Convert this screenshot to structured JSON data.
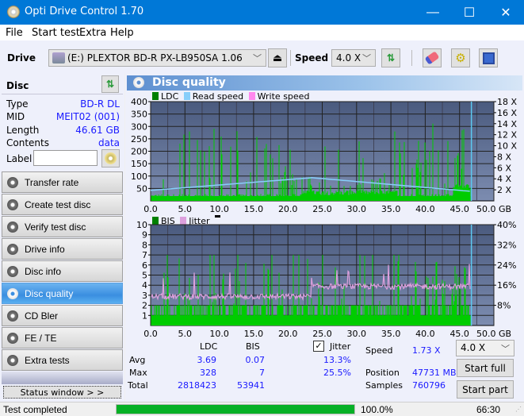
{
  "window": {
    "title": "Opti Drive Control 1.70",
    "minimize": "—",
    "maximize": "☐",
    "close": "✕"
  },
  "menu": [
    {
      "label": "File"
    },
    {
      "label": "Start test"
    },
    {
      "label": "Extra"
    },
    {
      "label": "Help"
    }
  ],
  "toolbar": {
    "drive_label": "Drive",
    "drive_value": "(E:)  PLEXTOR BD-R  PX-LB950SA 1.06",
    "speed_label": "Speed",
    "speed_value": "4.0 X"
  },
  "disc": {
    "header": "Disc",
    "fields": [
      {
        "label": "Type",
        "value": "BD-R DL"
      },
      {
        "label": "MID",
        "value": "MEIT02 (001)"
      },
      {
        "label": "Length",
        "value": "46.61 GB"
      },
      {
        "label": "Contents",
        "value": "data"
      }
    ],
    "label_field": {
      "label": "Label",
      "value": ""
    }
  },
  "nav": [
    {
      "label": "Transfer rate",
      "active": false
    },
    {
      "label": "Create test disc",
      "active": false
    },
    {
      "label": "Verify test disc",
      "active": false
    },
    {
      "label": "Drive info",
      "active": false
    },
    {
      "label": "Disc info",
      "active": false
    },
    {
      "label": "Disc quality",
      "active": true
    },
    {
      "label": "CD Bler",
      "active": false
    },
    {
      "label": "FE / TE",
      "active": false
    },
    {
      "label": "Extra tests",
      "active": false
    }
  ],
  "status_window_button": "Status window > >",
  "main": {
    "title": "Disc quality"
  },
  "chart_data": [
    {
      "type": "bar",
      "title": "LDC / Read speed",
      "legend": [
        "LDC",
        "Read speed",
        "Write speed"
      ],
      "legend_colors": {
        "LDC": "#008000",
        "Read speed": "#87cefa",
        "Write speed": "#ff88ee"
      },
      "xlabel": "GB",
      "x_ticks": [
        "0.0",
        "5.0",
        "10.0",
        "15.0",
        "20.0",
        "25.0",
        "30.0",
        "35.0",
        "40.0",
        "45.0",
        "50.0 GB"
      ],
      "xlim": [
        0,
        50
      ],
      "y_ticks": [
        "50",
        "100",
        "150",
        "200",
        "250",
        "300",
        "350",
        "400"
      ],
      "ylim": [
        0,
        400
      ],
      "y2_ticks": [
        "2 X",
        "4 X",
        "6 X",
        "8 X",
        "10 X",
        "12 X",
        "14 X",
        "16 X",
        "18 X"
      ],
      "y2lim": [
        0,
        18
      ],
      "data_end_gb": 46.61,
      "read_speed_start_x": 1.9,
      "read_speed_peak_x": 4.2,
      "read_speed_peak_gb": 23.5,
      "read_speed_end_x": 1.73,
      "ldc_peak": 328,
      "ldc_avg": 3.69
    },
    {
      "type": "bar",
      "title": "BIS / Jitter",
      "legend": [
        "BIS",
        "Jitter"
      ],
      "legend_colors": {
        "BIS": "#008000",
        "Jitter": "#dda0dd"
      },
      "xlabel": "GB",
      "x_ticks": [
        "0.0",
        "5.0",
        "10.0",
        "15.0",
        "20.0",
        "25.0",
        "30.0",
        "35.0",
        "40.0",
        "45.0",
        "50.0 GB"
      ],
      "xlim": [
        0,
        50
      ],
      "y_ticks": [
        "1",
        "2",
        "3",
        "4",
        "5",
        "6",
        "7",
        "8",
        "9",
        "10"
      ],
      "ylim": [
        0,
        10
      ],
      "y2_ticks": [
        "8%",
        "16%",
        "24%",
        "32%",
        "40%"
      ],
      "y2lim": [
        0,
        40
      ],
      "data_end_gb": 46.61,
      "bis_peak": 7,
      "jitter_first_half_pct": 11.5,
      "jitter_second_half_pct": 15.5
    }
  ],
  "stats": {
    "col_ldc": "LDC",
    "col_bis": "BIS",
    "jitter_label": "Jitter",
    "jitter_checked": true,
    "rows": [
      {
        "label": "Avg",
        "ldc": "3.69",
        "bis": "0.07",
        "jitter": "13.3%"
      },
      {
        "label": "Max",
        "ldc": "328",
        "bis": "7",
        "jitter": "25.5%"
      },
      {
        "label": "Total",
        "ldc": "2818423",
        "bis": "53941",
        "jitter": ""
      }
    ],
    "speed_label": "Speed",
    "speed_value": "1.73 X",
    "position_label": "Position",
    "position_value": "47731 MB",
    "samples_label": "Samples",
    "samples_value": "760796",
    "speed_select": "4.0 X",
    "start_full": "Start full",
    "start_part": "Start part"
  },
  "status": {
    "text": "Test completed",
    "progress": 100.0,
    "progress_label": "100.0%",
    "time": "66:30"
  },
  "colors": {
    "accent": "#0078d7",
    "plot_bg": "#5a6a8f",
    "bar_green": "#00cc00",
    "progress": "#06b025"
  }
}
